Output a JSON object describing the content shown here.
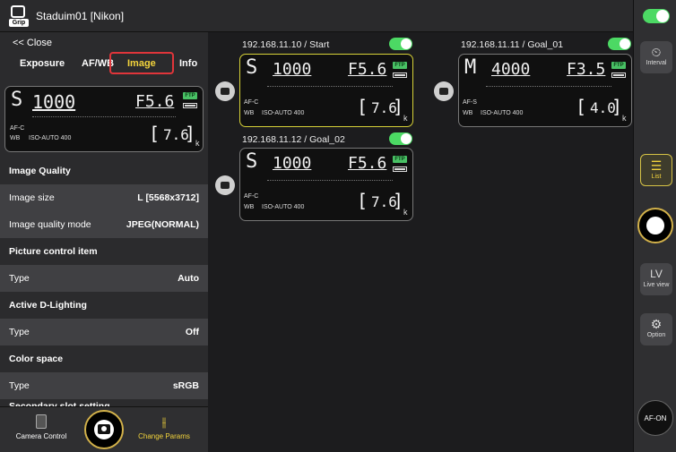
{
  "header": {
    "title": "Staduim01 [Nikon]",
    "grip_label": "Grip"
  },
  "left": {
    "close_label": "<< Close",
    "tabs": [
      {
        "label": "Exposure"
      },
      {
        "label": "AF/WB"
      },
      {
        "label": "Image"
      },
      {
        "label": "Info"
      }
    ],
    "active_tab": "Image",
    "lcd": {
      "mode": "S",
      "shutter": "1000",
      "aperture": "F5.6",
      "af": "AF-C",
      "iso": "ISO-AUTO 400",
      "shots": "7.6",
      "k": "k"
    },
    "settings": [
      {
        "type": "head",
        "label": "Image Quality"
      },
      {
        "type": "item",
        "label": "Image size",
        "value": "L [5568x3712]"
      },
      {
        "type": "item",
        "label": "Image quality mode",
        "value": "JPEG(NORMAL)"
      },
      {
        "type": "head",
        "label": "Picture control item"
      },
      {
        "type": "item",
        "label": "Type",
        "value": "Auto"
      },
      {
        "type": "head",
        "label": "Active D-Lighting"
      },
      {
        "type": "item",
        "label": "Type",
        "value": "Off"
      },
      {
        "type": "head",
        "label": "Color space"
      },
      {
        "type": "item",
        "label": "Type",
        "value": "sRGB"
      },
      {
        "type": "head",
        "label": "Secondary slot setting"
      }
    ],
    "bottom": {
      "camera_control": "Camera Control",
      "change_params": "Change Params"
    }
  },
  "cameras": [
    {
      "label": "192.168.11.10 / Start",
      "mode": "S",
      "shutter": "1000",
      "aperture": "F5.6",
      "af": "AF-C",
      "iso": "ISO-AUTO 400",
      "shots": "7.6",
      "selected": true
    },
    {
      "label": "192.168.11.12 / Goal_02",
      "mode": "S",
      "shutter": "1000",
      "aperture": "F5.6",
      "af": "AF-C",
      "iso": "ISO-AUTO 400",
      "shots": "7.6",
      "selected": false
    },
    {
      "label": "192.168.11.11 / Goal_01",
      "mode": "M",
      "shutter": "4000",
      "aperture": "F3.5",
      "af": "AF-S",
      "iso": "ISO-AUTO 400",
      "shots": "4.0",
      "selected": false
    }
  ],
  "lcd_common": {
    "wb": "WB",
    "ftp": "FTP",
    "k": "k"
  },
  "right": {
    "interval": "Interval",
    "list": "List",
    "live_view_big": "LV",
    "live_view": "Live view",
    "option": "Option",
    "afon": "AF-ON"
  }
}
